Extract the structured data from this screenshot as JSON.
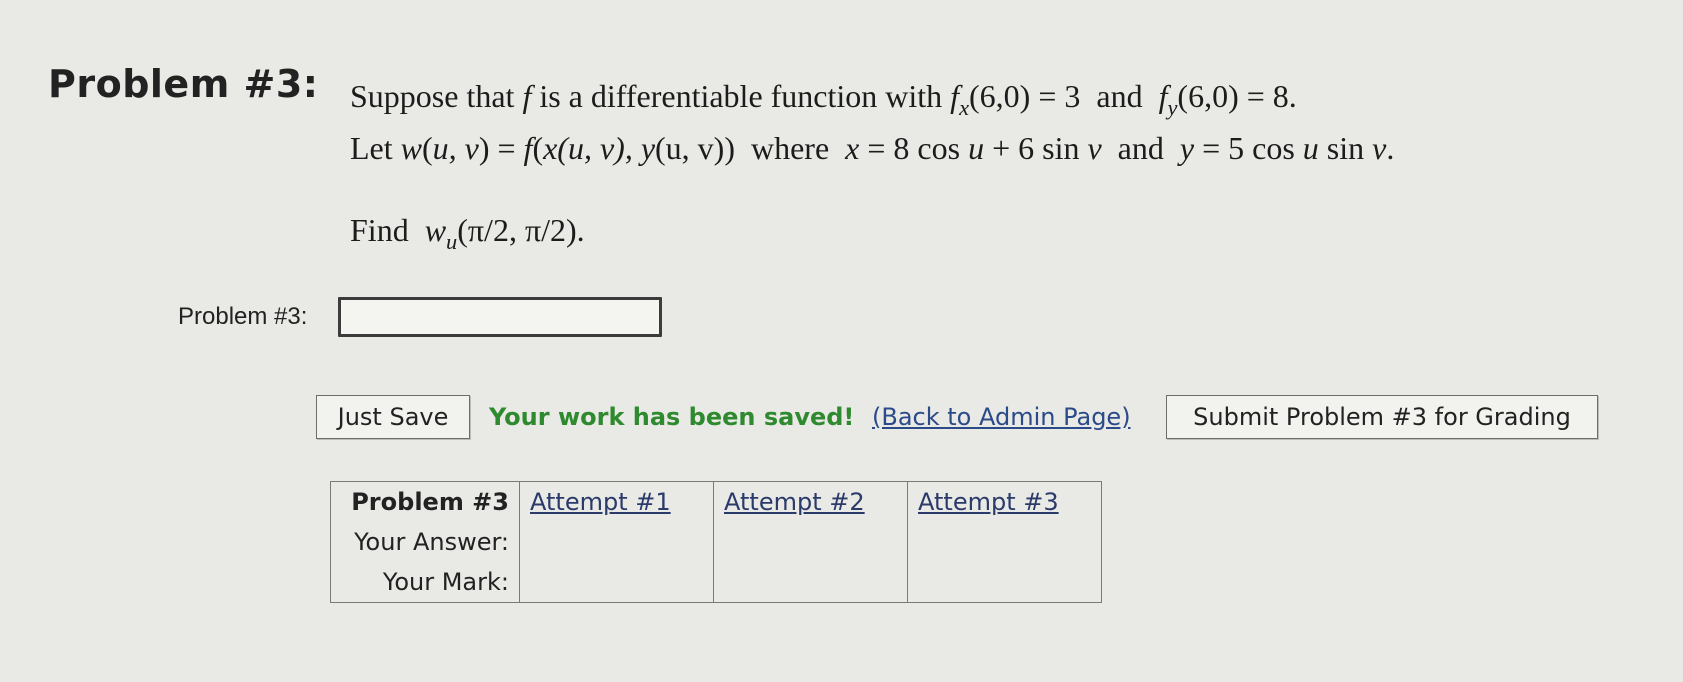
{
  "heading": "Problem #3:",
  "statement": {
    "line1": {
      "t1": "Suppose that ",
      "f": "f",
      "t2": " is a differentiable function with ",
      "fx": "f",
      "fx_sub": "x",
      "fx_rest": "(6,0) = 3",
      "and": "  and  ",
      "fy": "f",
      "fy_sub": "y",
      "fy_rest": "(6,0) = 8."
    },
    "line2": {
      "t1": "Let ",
      "w": "w",
      "t2": "(",
      "args": "u, v",
      "t3": ") = ",
      "f": "f",
      "t4": "(",
      "x": "x",
      "t5": "(u, v), ",
      "y": "y",
      "t6": "(u, v))  where  ",
      "xeq": "x",
      "xdef": " = 8 cos ",
      "u1": "u",
      "xdef2": " + 6 sin ",
      "v1": "v",
      "and": "  and  ",
      "yeq": "y",
      "ydef": " = 5 cos ",
      "u2": "u",
      "ydef2": " sin ",
      "v2": "v",
      "end": "."
    },
    "find": {
      "t1": "Find  ",
      "w": "w",
      "w_sub": "u",
      "args": "(π/2, π/2)."
    }
  },
  "answer": {
    "label": "Problem #3:",
    "value": "",
    "placeholder": ""
  },
  "actions": {
    "save_label": "Just Save",
    "saved_message": "Your work has been saved!",
    "admin_link": "(Back to Admin Page)",
    "submit_label": "Submit Problem #3 for Grading"
  },
  "attempts_table": {
    "header": "Problem #3",
    "attempts": [
      "Attempt #1",
      "Attempt #2",
      "Attempt #3"
    ],
    "rows": [
      {
        "label": "Your Answer:",
        "cells": [
          "",
          "",
          ""
        ]
      },
      {
        "label": "Your Mark:",
        "cells": [
          "",
          "",
          ""
        ]
      }
    ]
  },
  "colors": {
    "background": "#e9e9e5",
    "saved_green": "#2f8a2f",
    "link_blue": "#2a4a8a"
  }
}
